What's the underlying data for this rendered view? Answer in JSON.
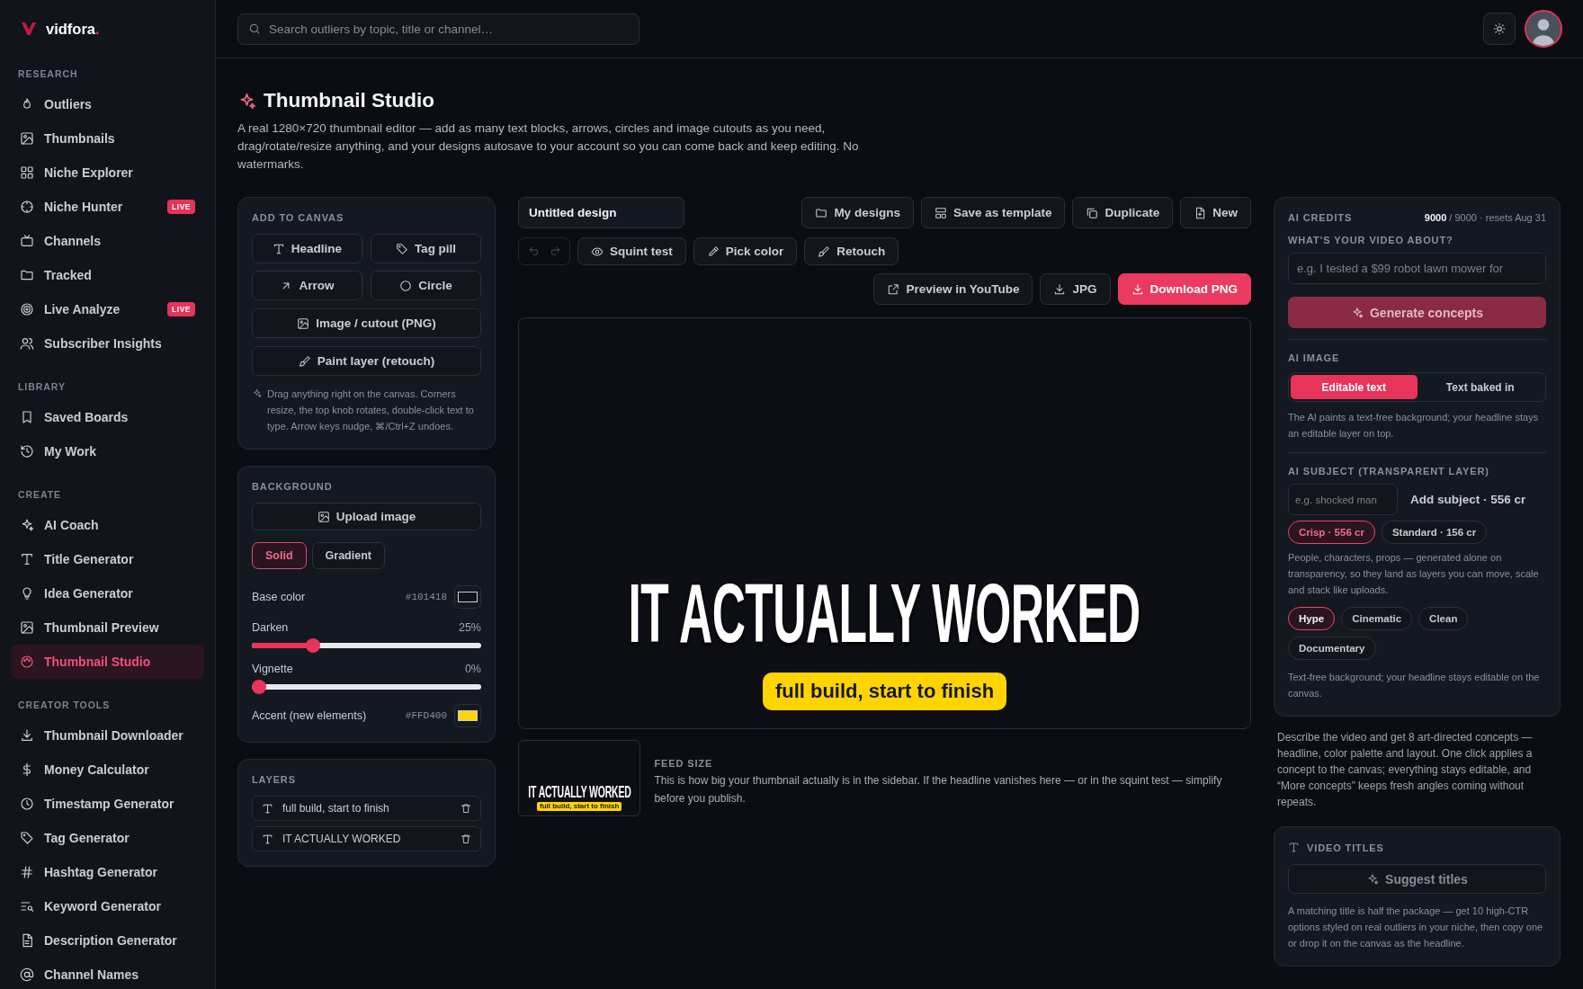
{
  "brand": {
    "name": "vidfora",
    "suffix": "."
  },
  "sidebar": {
    "sections": [
      {
        "title": "RESEARCH",
        "items": [
          {
            "label": "Outliers",
            "selected": false
          },
          {
            "label": "Thumbnails",
            "selected": false
          },
          {
            "label": "Niche Explorer",
            "selected": false
          },
          {
            "label": "Niche Hunter",
            "selected": false,
            "badge": "LIVE"
          },
          {
            "label": "Channels",
            "selected": false
          },
          {
            "label": "Tracked",
            "selected": false
          },
          {
            "label": "Live Analyze",
            "selected": false,
            "badge": "LIVE"
          },
          {
            "label": "Subscriber Insights",
            "selected": false
          }
        ]
      },
      {
        "title": "LIBRARY",
        "items": [
          {
            "label": "Saved Boards",
            "selected": false
          },
          {
            "label": "My Work",
            "selected": false
          }
        ]
      },
      {
        "title": "CREATE",
        "items": [
          {
            "label": "AI Coach",
            "selected": false
          },
          {
            "label": "Title Generator",
            "selected": false
          },
          {
            "label": "Idea Generator",
            "selected": false
          },
          {
            "label": "Thumbnail Preview",
            "selected": false
          },
          {
            "label": "Thumbnail Studio",
            "selected": true
          }
        ]
      },
      {
        "title": "CREATOR TOOLS",
        "items": [
          {
            "label": "Thumbnail Downloader",
            "selected": false
          },
          {
            "label": "Money Calculator",
            "selected": false
          },
          {
            "label": "Timestamp Generator",
            "selected": false
          },
          {
            "label": "Tag Generator",
            "selected": false
          },
          {
            "label": "Hashtag Generator",
            "selected": false
          },
          {
            "label": "Keyword Generator",
            "selected": false
          },
          {
            "label": "Description Generator",
            "selected": false
          },
          {
            "label": "Channel Names",
            "selected": false
          }
        ]
      }
    ]
  },
  "search": {
    "placeholder": "Search outliers by topic, title or channel…"
  },
  "page": {
    "title": "Thumbnail Studio",
    "description": "A real 1280×720 thumbnail editor — add as many text blocks, arrows, circles and image cutouts as you need, drag/rotate/resize anything, and your designs autosave to your account so you can come back and keep editing. No watermarks."
  },
  "add_to_canvas": {
    "title": "ADD TO CANVAS",
    "rows": [
      [
        "Headline",
        "Tag pill"
      ],
      [
        "Arrow",
        "Circle"
      ],
      [
        "Image / cutout (PNG)"
      ],
      [
        "Paint layer (retouch)"
      ]
    ],
    "hint": "Drag anything right on the canvas. Corners resize, the top knob rotates, double-click text to type. Arrow keys nudge, ⌘/Ctrl+Z undoes."
  },
  "background": {
    "title": "BACKGROUND",
    "upload": "Upload image",
    "modes": [
      {
        "label": "Solid",
        "selected": true
      },
      {
        "label": "Gradient",
        "selected": false
      }
    ],
    "base_color": {
      "label": "Base color",
      "value": "#101418"
    },
    "sliders": [
      {
        "label": "Darken",
        "reading": "25%",
        "level": 0.25
      },
      {
        "label": "Vignette",
        "reading": "0%",
        "level": 0
      }
    ],
    "accent": {
      "label": "Accent (new elements)",
      "value": "#FFD400"
    }
  },
  "layers": {
    "title": "LAYERS",
    "items": [
      "full build, start to finish",
      "IT ACTUALLY WORKED"
    ]
  },
  "editor": {
    "design_name": "Untitled design",
    "file_actions": [
      "My designs",
      "Save as template",
      "Duplicate",
      "New"
    ],
    "history": [
      {
        "kind": "undo",
        "disabled": true
      },
      {
        "kind": "redo",
        "disabled": true
      }
    ],
    "tools": [
      "Squint test",
      "Pick color",
      "Retouch"
    ],
    "exports": [
      {
        "label": "Preview in YouTube",
        "kind": "secondary"
      },
      {
        "label": "JPG",
        "kind": "secondary"
      },
      {
        "label": "Download PNG",
        "kind": "primary"
      }
    ]
  },
  "canvas": {
    "headline": "IT ACTUALLY WORKED",
    "tag": "full build, start to finish"
  },
  "feed_preview": {
    "headline": "IT ACTUALLY WORKED",
    "tag": "full build, start to finish",
    "title": "FEED SIZE",
    "description": "This is how big your thumbnail actually is in the sidebar. If the headline vanishes here — or in the squint test — simplify before you publish."
  },
  "ai": {
    "credits_label": "AI CREDITS",
    "credits": "**9000** / 9000 · resets Aug 31",
    "prompt_label": "WHAT'S YOUR VIDEO ABOUT?",
    "prompt_placeholder": "e.g. I tested a $99 robot lawn mower for",
    "generate": {
      "label": "Generate concepts",
      "disabled": true
    },
    "image_label": "AI IMAGE",
    "image_modes": [
      {
        "label": "Editable text",
        "selected": true
      },
      {
        "label": "Text baked in",
        "selected": false
      }
    ],
    "image_note": "The AI paints a text-free background; your headline stays an editable layer on top.",
    "subject_label": "AI SUBJECT (TRANSPARENT LAYER)",
    "subject_placeholder": "e.g. shocked man",
    "add_subject": "Add subject · 556 cr",
    "qualities": [
      {
        "label": "Crisp · 556 cr",
        "selected": true
      },
      {
        "label": "Standard · 156 cr",
        "selected": false
      }
    ],
    "subject_note": "People, characters, props — generated alone on transparency, so they land as layers you can move, scale and stack like uploads.",
    "styles": [
      {
        "label": "Hype",
        "selected": true
      },
      {
        "label": "Cinematic",
        "selected": false
      },
      {
        "label": "Clean",
        "selected": false
      },
      {
        "label": "Documentary",
        "selected": false
      }
    ],
    "style_note": "Text-free background; your headline stays editable on the canvas."
  },
  "ai_description": "Describe the video and get 8 art-directed concepts — headline, color palette and layout. One click applies a concept to the canvas; everything stays editable, and “More concepts” keeps fresh angles coming without repeats.",
  "video_titles": {
    "title": "VIDEO TITLES",
    "button": {
      "label": "Suggest titles",
      "disabled": true
    },
    "note": "A matching title is half the package — get 10 high-CTR options styled on real outliers in your niche, then copy one or drop it on the canvas as the headline."
  }
}
